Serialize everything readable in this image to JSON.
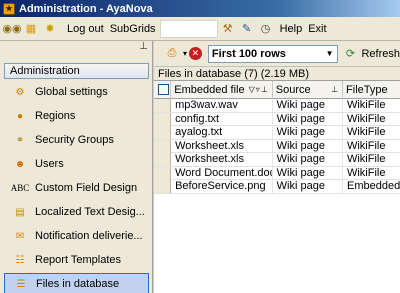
{
  "window": {
    "title": "Administration - AyaNova"
  },
  "toolbar": {
    "logout_label": "Log out",
    "subgrids_label": "SubGrids",
    "help_label": "Help",
    "exit_label": "Exit"
  },
  "sidebar": {
    "header": "Administration",
    "items": [
      {
        "label": "Global settings",
        "icon": "gear-icon"
      },
      {
        "label": "Regions",
        "icon": "globe-icon"
      },
      {
        "label": "Security Groups",
        "icon": "keys-icon"
      },
      {
        "label": "Users",
        "icon": "user-icon"
      },
      {
        "label": "Custom Field Design",
        "icon": "abc-icon"
      },
      {
        "label": "Localized Text Desig...",
        "icon": "text-edit-icon"
      },
      {
        "label": "Notification deliverie...",
        "icon": "notification-icon"
      },
      {
        "label": "Report Templates",
        "icon": "report-icon"
      },
      {
        "label": "Files in database",
        "icon": "files-icon"
      }
    ],
    "selected": "Files in database"
  },
  "grid_toolbar": {
    "filter_value": "First 100 rows",
    "refresh_label": "Refresh"
  },
  "grid": {
    "caption": "Files in database (7)  (2.19 MB)",
    "columns": [
      "Embedded file",
      "Source",
      "FileType"
    ],
    "rows": [
      {
        "name": "mp3wav.wav",
        "source": "Wiki page",
        "type": "WikiFile"
      },
      {
        "name": "config.txt",
        "source": "Wiki page",
        "type": "WikiFile"
      },
      {
        "name": "ayalog.txt",
        "source": "Wiki page",
        "type": "WikiFile"
      },
      {
        "name": "Worksheet.xls",
        "source": "Wiki page",
        "type": "WikiFile"
      },
      {
        "name": "Worksheet.xls",
        "source": "Wiki page",
        "type": "WikiFile"
      },
      {
        "name": "Word Document.doc",
        "source": "Wiki page",
        "type": "WikiFile"
      },
      {
        "name": "BeforeService.png",
        "source": "Wiki page",
        "type": "Embedded"
      }
    ]
  },
  "colors": {
    "title_bar": "#0a246a",
    "selected_item": "#c1d2ee",
    "selected_border": "#316ac5"
  }
}
